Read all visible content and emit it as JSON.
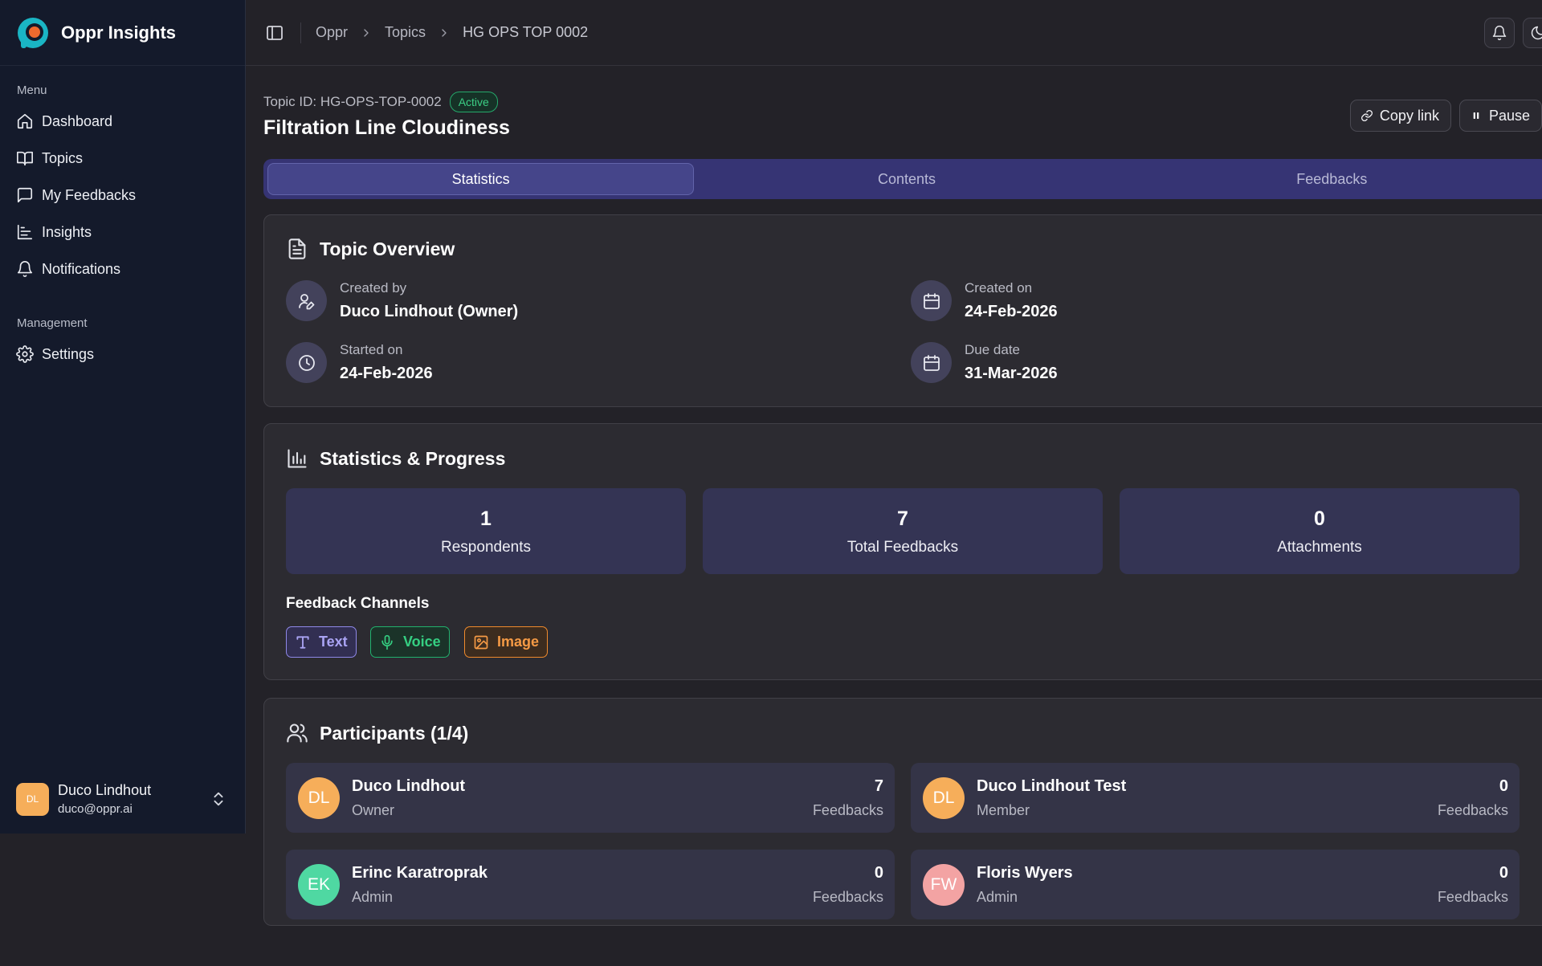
{
  "app": {
    "name": "Oppr Insights"
  },
  "sidebar": {
    "menu_label": "Menu",
    "items": [
      {
        "label": "Dashboard",
        "icon": "home-icon"
      },
      {
        "label": "Topics",
        "icon": "book-open-icon"
      },
      {
        "label": "My Feedbacks",
        "icon": "message-square-icon"
      },
      {
        "label": "Insights",
        "icon": "bar-chart-icon"
      },
      {
        "label": "Notifications",
        "icon": "bell-icon"
      }
    ],
    "management_label": "Management",
    "management_items": [
      {
        "label": "Settings",
        "icon": "gear-icon"
      }
    ],
    "user": {
      "initials": "DL",
      "name": "Duco Lindhout",
      "email": "duco@oppr.ai"
    }
  },
  "topbar": {
    "breadcrumb": [
      "Oppr",
      "Topics",
      "HG OPS TOP 0002"
    ]
  },
  "topic": {
    "id_label": "Topic ID: HG-OPS-TOP-0002",
    "status": "Active",
    "title": "Filtration Line Cloudiness"
  },
  "actions": {
    "copy_link": "Copy link",
    "pause": "Pause"
  },
  "tabs": [
    {
      "label": "Statistics",
      "active": true
    },
    {
      "label": "Contents",
      "active": false
    },
    {
      "label": "Feedbacks",
      "active": false
    }
  ],
  "overview": {
    "title": "Topic Overview",
    "created_by_label": "Created by",
    "created_by_value": "Duco Lindhout (Owner)",
    "created_on_label": "Created on",
    "created_on_value": "24-Feb-2026",
    "started_on_label": "Started on",
    "started_on_value": "24-Feb-2026",
    "due_date_label": "Due date",
    "due_date_value": "31-Mar-2026"
  },
  "stats": {
    "title": "Statistics & Progress",
    "boxes": [
      {
        "value": "1",
        "label": "Respondents"
      },
      {
        "value": "7",
        "label": "Total Feedbacks"
      },
      {
        "value": "0",
        "label": "Attachments"
      }
    ],
    "channels_title": "Feedback Channels",
    "channels": [
      {
        "label": "Text",
        "color": "#8f88e8"
      },
      {
        "label": "Voice",
        "color": "#21b26e"
      },
      {
        "label": "Image",
        "color": "#f08a2c"
      }
    ]
  },
  "participants": {
    "title": "Participants (1/4)",
    "list": [
      {
        "initials": "DL",
        "name": "Duco Lindhout",
        "role": "Owner",
        "count": "7",
        "count_label": "Feedbacks",
        "color": "#f6ae5a"
      },
      {
        "initials": "DL",
        "name": "Duco Lindhout Test",
        "role": "Member",
        "count": "0",
        "count_label": "Feedbacks",
        "color": "#f6ae5a"
      },
      {
        "initials": "EK",
        "name": "Erinc Karatroprak",
        "role": "Admin",
        "count": "0",
        "count_label": "Feedbacks",
        "color": "#4fd8a2"
      },
      {
        "initials": "FW",
        "name": "Floris Wyers",
        "role": "Admin",
        "count": "0",
        "count_label": "Feedbacks",
        "color": "#f3a3a3"
      }
    ]
  },
  "colors": {
    "accent": "#363474",
    "sidebar_bg": "#141a2b",
    "page_bg": "#232228",
    "status_active": "#3ccf85"
  }
}
